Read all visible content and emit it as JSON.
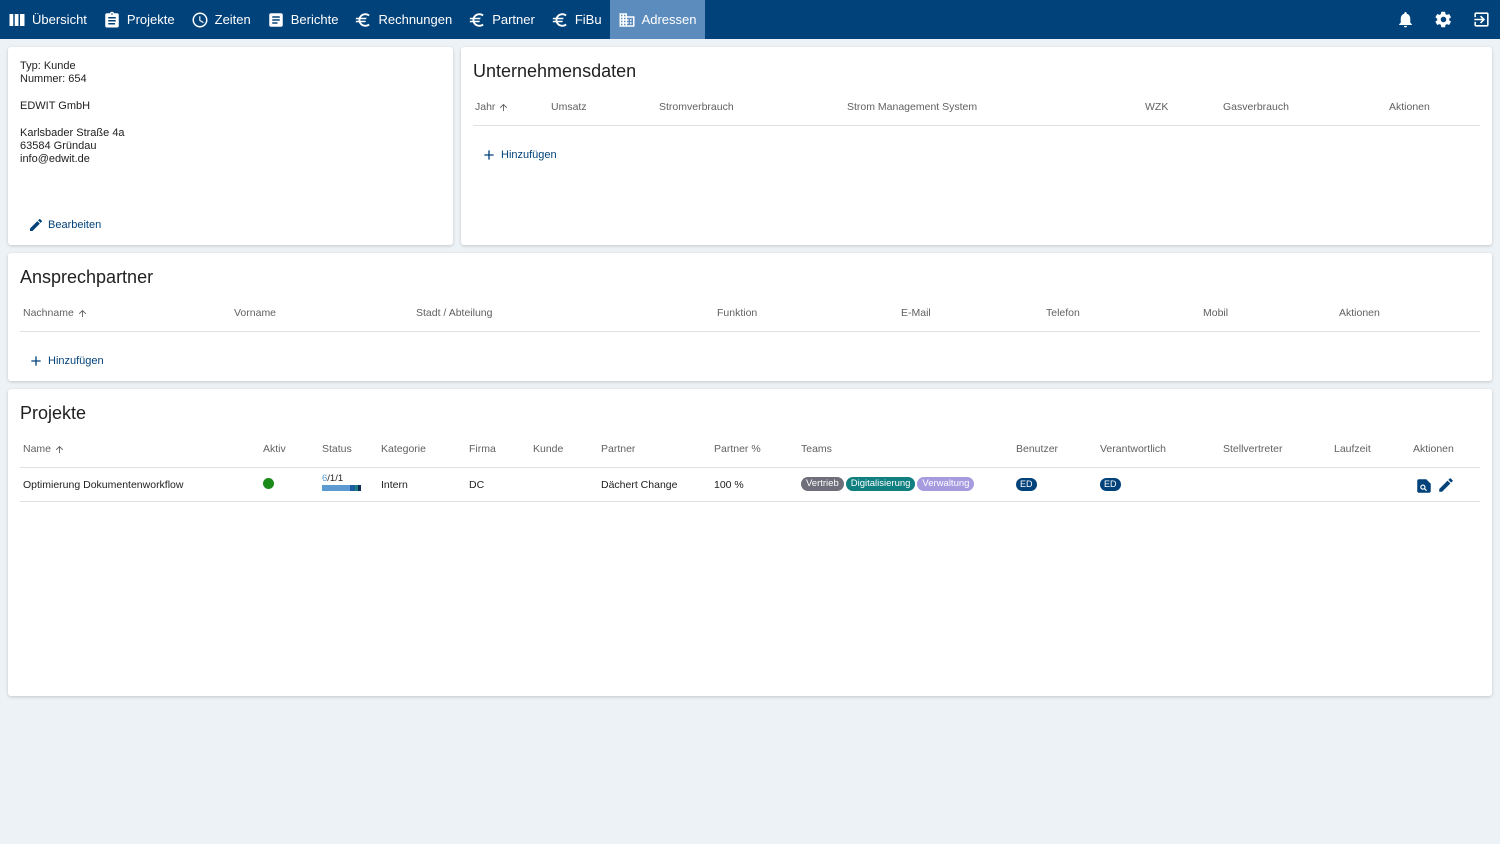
{
  "nav": {
    "items": [
      {
        "label": "Übersicht",
        "icon": "columns-icon",
        "active": false
      },
      {
        "label": "Projekte",
        "icon": "clipboard-icon",
        "active": false
      },
      {
        "label": "Zeiten",
        "icon": "clock-icon",
        "active": false
      },
      {
        "label": "Berichte",
        "icon": "document-icon",
        "active": false
      },
      {
        "label": "Rechnungen",
        "icon": "euro-icon",
        "active": false
      },
      {
        "label": "Partner",
        "icon": "euro-icon",
        "active": false
      },
      {
        "label": "FiBu",
        "icon": "euro-icon",
        "active": false
      },
      {
        "label": "Adressen",
        "icon": "building-icon",
        "active": true
      }
    ],
    "right_icons": [
      "bell-icon",
      "gear-icon",
      "logout-icon"
    ]
  },
  "address": {
    "type_line": "Typ: Kunde",
    "number_line": "Nummer: 654",
    "company": "EDWIT GmbH",
    "street": "Karlsbader Straße 4a",
    "city": "63584 Gründau",
    "email": "info@edwit.de",
    "edit_label": "Bearbeiten"
  },
  "company_data": {
    "title": "Unternehmensdaten",
    "columns": [
      "Jahr",
      "Umsatz",
      "Stromverbrauch",
      "Strom Management System",
      "WZK",
      "Gasverbrauch",
      "Aktionen"
    ],
    "add_label": "Hinzufügen"
  },
  "contacts": {
    "title": "Ansprechpartner",
    "columns": [
      "Nachname",
      "Vorname",
      "Stadt / Abteilung",
      "Funktion",
      "E-Mail",
      "Telefon",
      "Mobil",
      "Aktionen"
    ],
    "add_label": "Hinzufügen"
  },
  "projects": {
    "title": "Projekte",
    "columns": [
      "Name",
      "Aktiv",
      "Status",
      "Kategorie",
      "Firma",
      "Kunde",
      "Partner",
      "Partner %",
      "Teams",
      "Benutzer",
      "Verantwortlich",
      "Stellvertreter",
      "Laufzeit",
      "Aktionen"
    ],
    "rows": [
      {
        "name": "Optimierung Dokumentenworkflow",
        "active": true,
        "status_a": "6",
        "status_b": "/1/1",
        "category": "Intern",
        "company": "DC",
        "customer": "",
        "partner": "Dächert Change",
        "partner_pct": "100 %",
        "teams": [
          {
            "label": "Vertrieb",
            "color": "#6f6f7b"
          },
          {
            "label": "Digitalisierung",
            "color": "#0f7f7f"
          },
          {
            "label": "Verwaltung",
            "color": "#a79be0"
          }
        ],
        "user": "ED",
        "responsible": "ED",
        "deputy": "",
        "duration": ""
      }
    ]
  },
  "colors": {
    "brand": "#01427a",
    "active_tab": "#5c8cbd",
    "active_dot": "#1a8a1a",
    "background": "#edf2f6"
  }
}
